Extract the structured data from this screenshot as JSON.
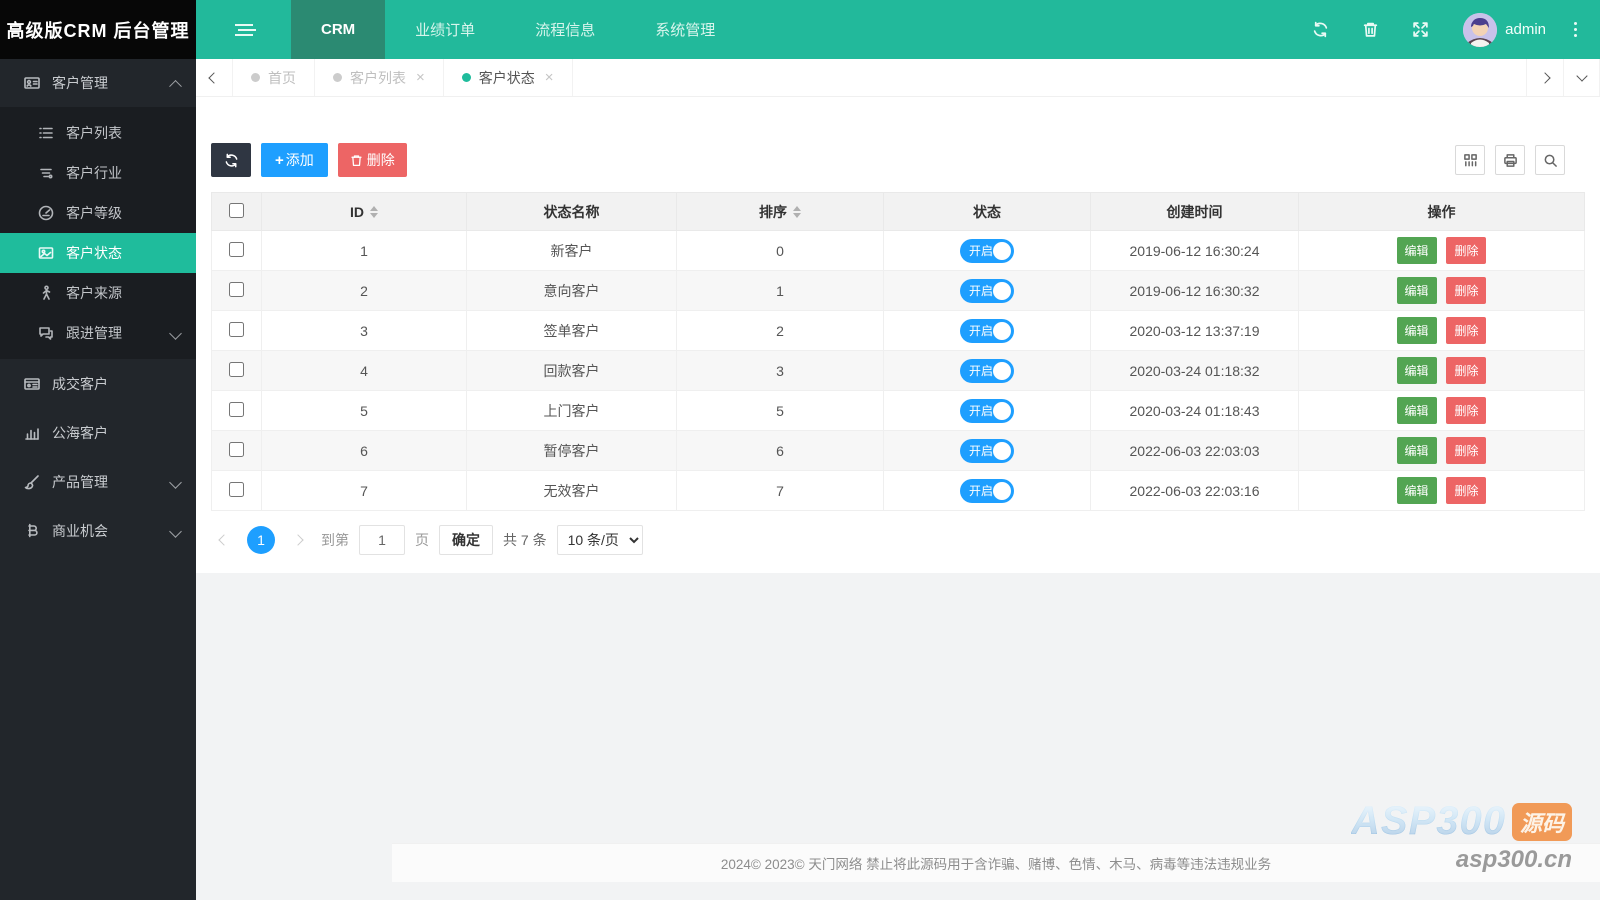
{
  "app": {
    "logo_title": "高级版CRM 后台管理",
    "username": "admin"
  },
  "topnav": {
    "items": [
      {
        "label": "CRM"
      },
      {
        "label": "业绩订单"
      },
      {
        "label": "流程信息"
      },
      {
        "label": "系统管理"
      }
    ]
  },
  "sidebar": {
    "group_customer": {
      "label": "客户管理"
    },
    "submenu": [
      {
        "label": "客户列表"
      },
      {
        "label": "客户行业"
      },
      {
        "label": "客户等级"
      },
      {
        "label": "客户状态"
      },
      {
        "label": "客户来源"
      },
      {
        "label": "跟进管理"
      }
    ],
    "items": [
      {
        "label": "成交客户"
      },
      {
        "label": "公海客户"
      },
      {
        "label": "产品管理"
      },
      {
        "label": "商业机会"
      }
    ]
  },
  "tabs": [
    {
      "label": "首页"
    },
    {
      "label": "客户列表",
      "close": "×"
    },
    {
      "label": "客户状态",
      "close": "×"
    }
  ],
  "toolbar": {
    "add_label": "添加",
    "add_plus": "+",
    "delete_label": "删除"
  },
  "table": {
    "headers": {
      "id": "ID",
      "name": "状态名称",
      "sort": "排序",
      "status": "状态",
      "created": "创建时间",
      "action": "操作"
    },
    "toggle_on_label": "开启",
    "edit_label": "编辑",
    "delete_label": "删除",
    "rows": [
      {
        "id": "1",
        "name": "新客户",
        "sort": "0",
        "created": "2019-06-12 16:30:24"
      },
      {
        "id": "2",
        "name": "意向客户",
        "sort": "1",
        "created": "2019-06-12 16:30:32"
      },
      {
        "id": "3",
        "name": "签单客户",
        "sort": "2",
        "created": "2020-03-12 13:37:19"
      },
      {
        "id": "4",
        "name": "回款客户",
        "sort": "3",
        "created": "2020-03-24 01:18:32"
      },
      {
        "id": "5",
        "name": "上门客户",
        "sort": "5",
        "created": "2020-03-24 01:18:43"
      },
      {
        "id": "6",
        "name": "暂停客户",
        "sort": "6",
        "created": "2022-06-03 22:03:03"
      },
      {
        "id": "7",
        "name": "无效客户",
        "sort": "7",
        "created": "2022-06-03 22:03:16"
      }
    ]
  },
  "pagination": {
    "current_page": "1",
    "goto_label": "到第",
    "page_input_value": "1",
    "page_unit_label": "页",
    "confirm_label": "确定",
    "total_label": "共 7 条",
    "per_page_option": "10 条/页"
  },
  "footer": {
    "copyright": "2024© 2023© 天门网络 禁止将此源码用于含诈骗、赌博、色情、木马、病毒等违法违规业务"
  },
  "watermark": {
    "brand": "ASP300",
    "badge": "源码",
    "domain": "asp300.cn"
  },
  "colors": {
    "navbar_teal": "#22b99b",
    "navbar_active_teal": "#2b8a72",
    "sidebar_dark": "#22262b",
    "submenu_dark": "#1a1d21",
    "active_green": "#1fbc9c",
    "primary_blue": "#1e9fff",
    "edit_green": "#53a553",
    "danger_red": "#ed6565",
    "dark_button": "#2f3642"
  }
}
